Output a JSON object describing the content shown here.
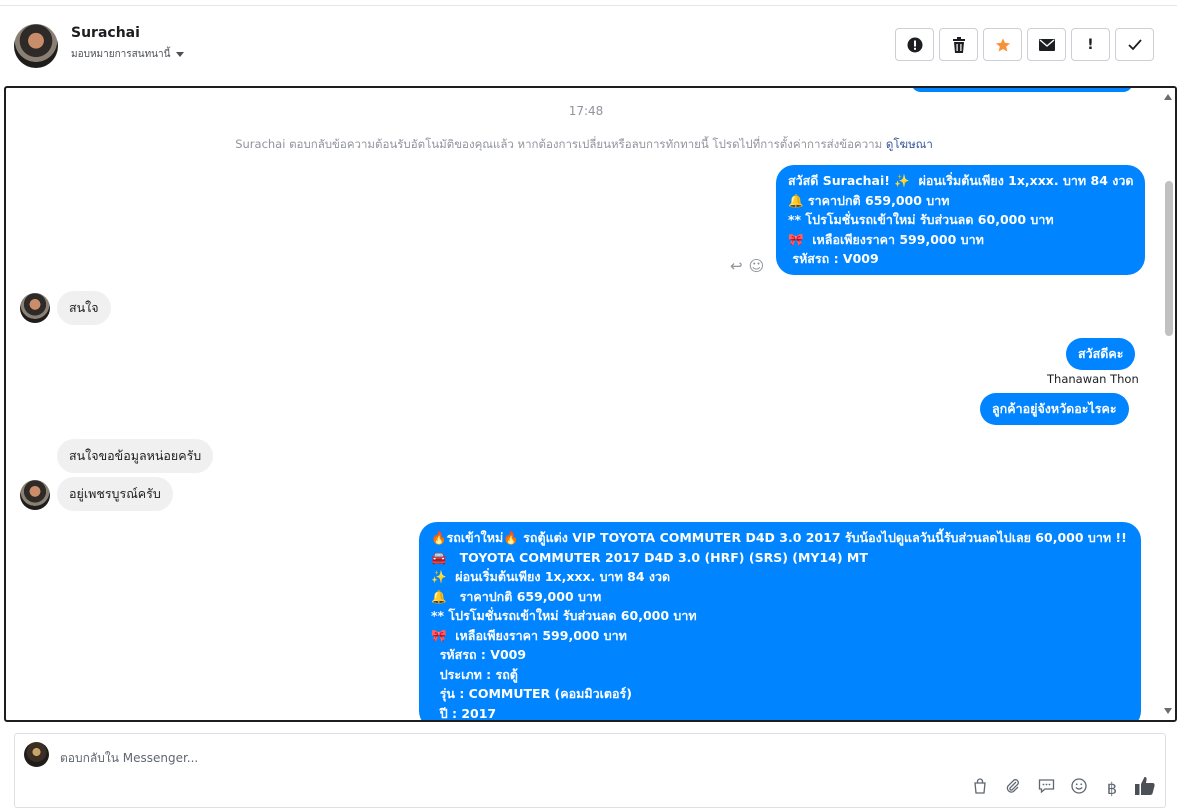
{
  "header": {
    "contact_name": "Surachai",
    "assign_label": "มอบหมายการสนทนานี้",
    "actions": [
      {
        "name": "alert-icon",
        "glyph": "⬤"
      },
      {
        "name": "trash-icon",
        "glyph": "🗑"
      },
      {
        "name": "star-icon",
        "glyph": "★"
      },
      {
        "name": "mail-icon",
        "glyph": "✉"
      },
      {
        "name": "exclamation-icon",
        "glyph": "!"
      },
      {
        "name": "check-icon",
        "glyph": "✓"
      }
    ]
  },
  "chat": {
    "time": "17:48",
    "notice": "Surachai ตอบกลับข้อความต้อนรับอัตโนมัติของคุณแล้ว หากต้องการเปลี่ยนหรือลบการทักทายนี้ โปรดไปที่การตั้งค่าการส่งข้อความ",
    "notice_link": "ดูโฆษณา",
    "messages": {
      "auto_welcome": "สวัสดี Surachai! ✨  ผ่อนเริ่มต้นเพียง 1x,xxx. บาท 84 งวด\n🔔 ราคาปกติ 659,000 บาท\n** โปรโมชั่นรถเข้าใหม่ รับส่วนลด 60,000 บาท\n🎀  เหลือเพียงราคา 599,000 บาท\n รหัสรถ : V009",
      "in_1": "สนใจ",
      "out_1": "สวัสดีคะ",
      "sender": "Thanawan Thon",
      "out_2": "ลูกค้าอยู่จังหวัดอะไรคะ",
      "in_2": "สนใจขอข้อมูลหน่อยครับ",
      "in_3": "อยู่เพชรบูรณ์ครับ",
      "ad_details": "🔥รถเข้าใหม่🔥 รถตู้แต่ง VIP TOYOTA COMMUTER D4D 3.0 2017 รับน้องไปดูแลวันนี้รับส่วนลดไปเลย 60,000 บาท !!\n🚘   TOYOTA COMMUTER 2017 D4D 3.0 (HRF) (SRS) (MY14) MT\n✨  ผ่อนเริ่มต้นเพียง 1x,xxx. บาท 84 งวด\n🔔   ราคาปกติ 659,000 บาท\n** โปรโมชั่นรถเข้าใหม่ รับส่วนลด 60,000 บาท\n🎀  เหลือเพียงราคา 599,000 บาท\n  รหัสรถ : V009\n  ประเภท : รถตู้\n  รุ่น : COMMUTER (คอมมิวเตอร์)\n  ปี : 2017"
    }
  },
  "composer": {
    "placeholder": "ตอบกลับใน Messenger...",
    "tools": [
      {
        "name": "bag-icon",
        "glyph": "👜"
      },
      {
        "name": "attachment-icon",
        "glyph": "🔗"
      },
      {
        "name": "saved-reply-icon",
        "glyph": "💬"
      },
      {
        "name": "emoji-icon",
        "glyph": "☺"
      },
      {
        "name": "baht-icon",
        "glyph": "฿"
      },
      {
        "name": "like-icon",
        "glyph": "👍"
      }
    ]
  },
  "colors": {
    "outgoing_bubble": "#0084ff",
    "incoming_bubble": "#f1f0f0",
    "star": "#f7923b"
  }
}
